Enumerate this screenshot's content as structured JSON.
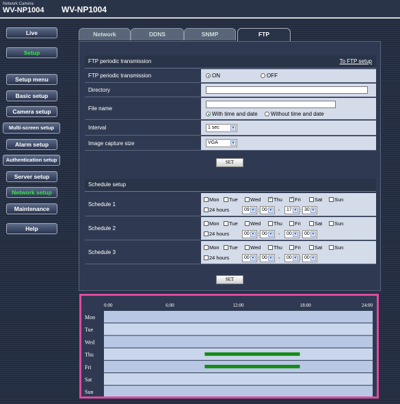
{
  "header": {
    "brand_small": "Network Camera",
    "brand": "WV-NP1004",
    "model": "WV-NP1004"
  },
  "nav": {
    "live": "Live",
    "setup": "Setup",
    "setup_menu": "Setup menu",
    "basic": "Basic setup",
    "camera": "Camera setup",
    "multiscreen": "Multi-screen setup",
    "alarm": "Alarm setup",
    "auth": "Authentication setup",
    "server": "Server setup",
    "network": "Network setup",
    "maintenance": "Maintenance",
    "help": "Help"
  },
  "tabs": [
    "Network",
    "DDNS",
    "SNMP",
    "FTP"
  ],
  "ftp": {
    "title": "FTP periodic transmission",
    "link": "To FTP setup",
    "periodic_label": "FTP periodic transmission",
    "on": "ON",
    "off": "OFF",
    "directory_label": "Directory",
    "directory_value": "",
    "filename_label": "File name",
    "filename_value": "",
    "with_time": "With time and date",
    "without_time": "Without time and date",
    "interval_label": "Interval",
    "interval_value": "1 sec",
    "capture_label": "Image capture size",
    "capture_value": "VGA",
    "set": "SET"
  },
  "schedule": {
    "title": "Schedule setup",
    "days": [
      "Mon",
      "Tue",
      "Wed",
      "Thu",
      "Fri",
      "Sat",
      "Sun"
    ],
    "hours24": "24 hours",
    "set": "SET",
    "rows": [
      {
        "label": "Schedule 1",
        "checked": [
          "Thu",
          "Fri"
        ],
        "from_h": "09",
        "from_m": "00",
        "to_h": "17",
        "to_m": "30"
      },
      {
        "label": "Schedule 2",
        "checked": [],
        "from_h": "00",
        "from_m": "00",
        "to_h": "00",
        "to_m": "00"
      },
      {
        "label": "Schedule 3",
        "checked": [],
        "from_h": "00",
        "from_m": "00",
        "to_h": "00",
        "to_m": "00"
      }
    ]
  },
  "timeline": {
    "hours": [
      "0:00",
      "6:00",
      "12:00",
      "18:00",
      "24:00"
    ],
    "days": [
      "Mon",
      "Tue",
      "Wed",
      "Thu",
      "Fri",
      "Sat",
      "Sun"
    ],
    "bars": [
      {
        "day": "Thu",
        "start": 9.0,
        "end": 17.5
      },
      {
        "day": "Fri",
        "start": 9.0,
        "end": 17.5
      }
    ],
    "bar_color": "#138a13"
  },
  "colors": {
    "accent": "#36e24a",
    "highlight": "#e04aa0"
  }
}
